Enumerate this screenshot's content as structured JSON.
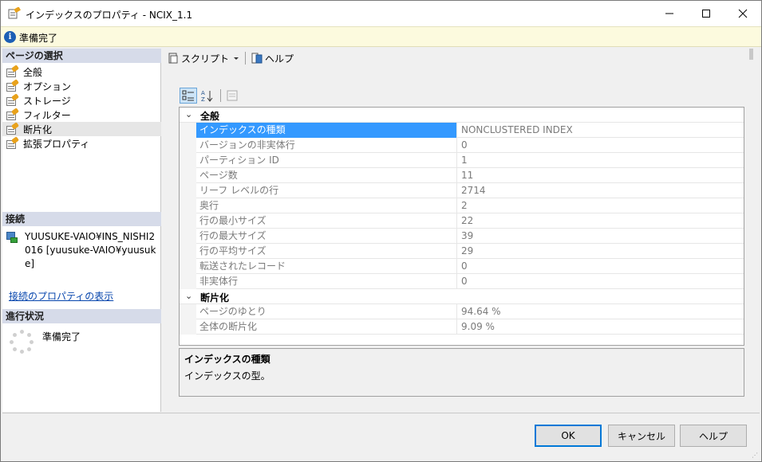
{
  "window": {
    "title": "インデックスのプロパティ - NCIX_1.1",
    "minimize_icon": "minimize-icon",
    "maximize_icon": "maximize-icon",
    "close_icon": "close-icon"
  },
  "status": {
    "text": "準備完了",
    "icon": "info-icon"
  },
  "left": {
    "select_page_header": "ページの選択",
    "pages": [
      {
        "label": "全般",
        "selected": false
      },
      {
        "label": "オプション",
        "selected": false
      },
      {
        "label": "ストレージ",
        "selected": false
      },
      {
        "label": "フィルター",
        "selected": false
      },
      {
        "label": "断片化",
        "selected": true
      },
      {
        "label": "拡張プロパティ",
        "selected": false
      }
    ],
    "connection_header": "接続",
    "connection_text": "YUUSUKE-VAIO¥INS_NISHI2016 [yuusuke-VAIO¥yuusuke]",
    "connection_link": "接続のプロパティの表示",
    "progress_header": "進行状況",
    "progress_text": "準備完了"
  },
  "toolbar": {
    "script_label": "スクリプト",
    "help_label": "ヘルプ"
  },
  "grid": {
    "categories": [
      {
        "label": "全般",
        "properties": [
          {
            "name": "インデックスの種類",
            "value": "NONCLUSTERED INDEX",
            "selected": true
          },
          {
            "name": "バージョンの非実体行",
            "value": "0"
          },
          {
            "name": "パーティション ID",
            "value": "1"
          },
          {
            "name": "ページ数",
            "value": "11"
          },
          {
            "name": "リーフ レベルの行",
            "value": "2714"
          },
          {
            "name": "奥行",
            "value": "2"
          },
          {
            "name": "行の最小サイズ",
            "value": "22"
          },
          {
            "name": "行の最大サイズ",
            "value": "39"
          },
          {
            "name": "行の平均サイズ",
            "value": "29"
          },
          {
            "name": "転送されたレコード",
            "value": "0"
          },
          {
            "name": "非実体行",
            "value": "0"
          }
        ]
      },
      {
        "label": "断片化",
        "properties": [
          {
            "name": "ページのゆとり",
            "value": "94.64 %"
          },
          {
            "name": "全体の断片化",
            "value": "9.09 %"
          }
        ]
      }
    ]
  },
  "description": {
    "title": "インデックスの種類",
    "body": "インデックスの型。"
  },
  "buttons": {
    "ok": "OK",
    "cancel": "キャンセル",
    "help": "ヘルプ"
  },
  "colors": {
    "selection": "#3399ff",
    "status_bg": "#fcfade",
    "section_header_bg": "#d6dbe9",
    "link": "#0645ad"
  }
}
